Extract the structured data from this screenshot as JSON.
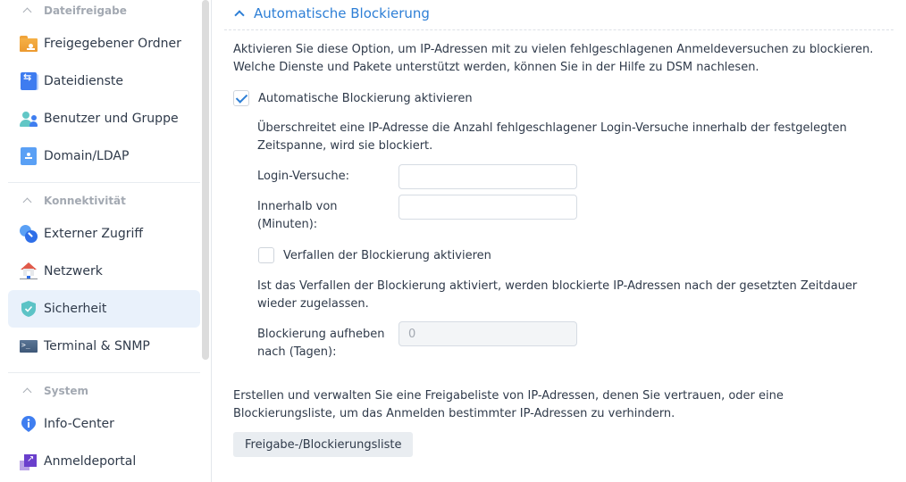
{
  "sidebar": {
    "groups": [
      {
        "label": "Dateifreigabe",
        "items": [
          {
            "label": "Freigegebener Ordner",
            "icon": "shared-folder-icon"
          },
          {
            "label": "Dateidienste",
            "icon": "file-services-icon"
          },
          {
            "label": "Benutzer und Gruppe",
            "icon": "user-group-icon"
          },
          {
            "label": "Domain/LDAP",
            "icon": "domain-ldap-icon"
          }
        ]
      },
      {
        "label": "Konnektivität",
        "items": [
          {
            "label": "Externer Zugriff",
            "icon": "external-access-icon"
          },
          {
            "label": "Netzwerk",
            "icon": "network-icon"
          },
          {
            "label": "Sicherheit",
            "icon": "shield-icon",
            "active": true
          },
          {
            "label": "Terminal & SNMP",
            "icon": "terminal-icon"
          }
        ]
      },
      {
        "label": "System",
        "items": [
          {
            "label": "Info-Center",
            "icon": "info-icon"
          },
          {
            "label": "Anmeldeportal",
            "icon": "login-portal-icon"
          }
        ]
      }
    ]
  },
  "main": {
    "section_title": "Automatische Blockierung",
    "intro_line1": "Aktivieren Sie diese Option, um IP-Adressen mit zu vielen fehlgeschlagenen Anmeldeversuchen zu blockieren.",
    "intro_line2": "Welche Dienste und Pakete unterstützt werden, können Sie in der Hilfe zu DSM nachlesen.",
    "auto_block": {
      "label": "Automatische Blockierung aktivieren",
      "checked": true
    },
    "threshold_desc_line1": "Überschreitet eine IP-Adresse die Anzahl fehlgeschlagener Login-Versuche innerhalb der festgelegten",
    "threshold_desc_line2": "Zeitspanne, wird sie blockiert.",
    "login_attempts": {
      "label": "Login-Versuche:",
      "value": ""
    },
    "within_minutes": {
      "label_line1": "Innerhalb von",
      "label_line2": "(Minuten):",
      "value": ""
    },
    "expiry": {
      "label": "Verfallen der Blockierung aktivieren",
      "checked": false
    },
    "expiry_desc_line1": "Ist das Verfallen der Blockierung aktiviert, werden blockierte IP-Adressen nach der gesetzten Zeitdauer",
    "expiry_desc_line2": "wieder zugelassen.",
    "unblock_days": {
      "label_line1": "Blockierung aufheben",
      "label_line2": "nach (Tagen):",
      "value": "0",
      "disabled": true
    },
    "list_desc_line1": "Erstellen und verwalten Sie eine Freigabeliste von IP-Adressen, denen Sie vertrauen, oder eine",
    "list_desc_line2": "Blockierungsliste, um das Anmelden bestimmter IP-Adressen zu verhindern.",
    "list_button": "Freigabe-/Blockierungsliste"
  },
  "colors": {
    "accent": "#2e7fd6",
    "active_bg": "#e9f1fb",
    "muted_text": "#a3a9b2",
    "text": "#2f3a4a"
  }
}
